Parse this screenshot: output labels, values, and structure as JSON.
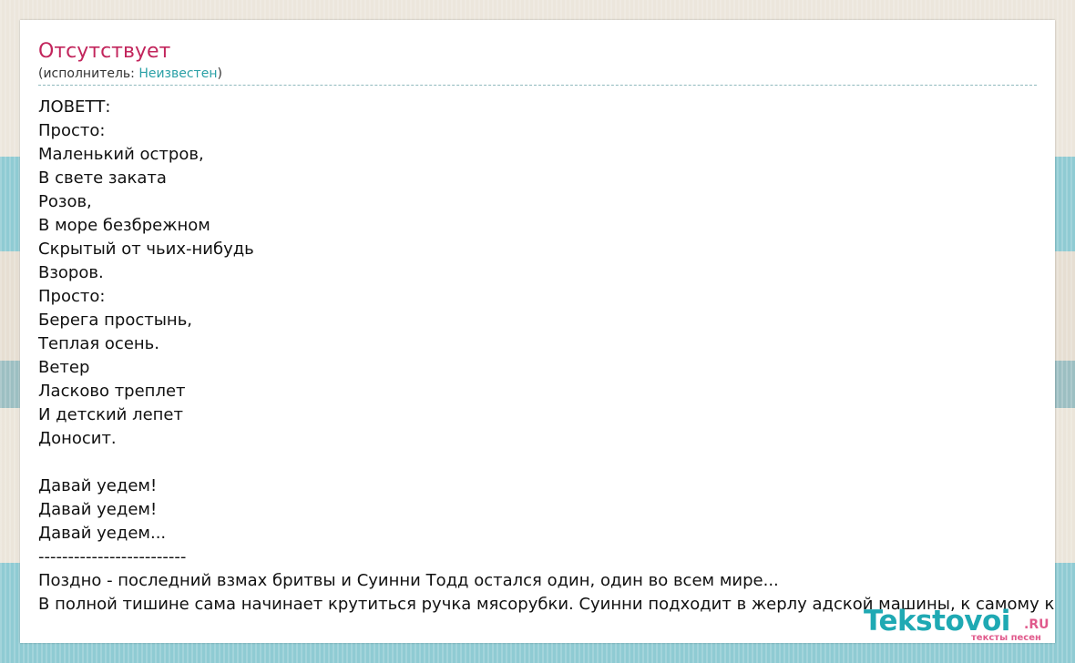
{
  "song": {
    "title": "Отсутствует",
    "artist_prefix": "(исполнитель: ",
    "artist_name": "Неизвестен",
    "artist_suffix": ")"
  },
  "lyrics": [
    "ЛОВЕТТ:",
    "Просто:",
    "Маленький остров,",
    "В свете заката",
    "Розов,",
    "В море безбрежном",
    "Скрытый от чьих-нибудь",
    "Взоров.",
    "Просто:",
    "Берега простынь,",
    "Теплая осень.",
    "Ветер",
    "Ласково треплет",
    "И детский лепет",
    "Доносит.",
    "",
    "Давай уедем!",
    "Давай уедем!",
    "Давай уедем...",
    "-------------------------",
    "Поздно - последний взмах бритвы и Суинни Тодд остался один, один во всем мире...",
    "В полной тишине сама начинает крутиться ручка мясорубки. Суинни подходит в жерлу адской машины, к самому краю..."
  ],
  "logo": {
    "main": "Tekstovoi",
    "tld": ".RU",
    "subtitle": "тексты песен"
  },
  "colors": {
    "title": "#c2255c",
    "link": "#2aa0a6",
    "logo_main": "#1fa9b3",
    "logo_accent": "#e05a8c"
  }
}
